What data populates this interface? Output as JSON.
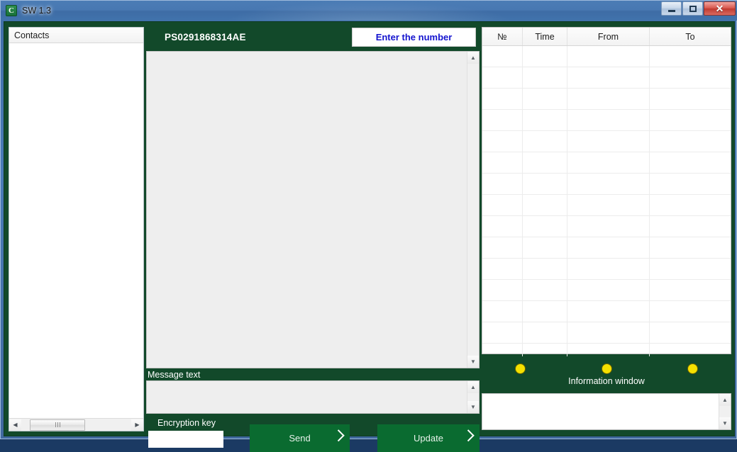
{
  "window": {
    "title": "SW 1.3",
    "app_icon": "app-logo-icon",
    "controls": {
      "minimize": "minimize-icon",
      "maximize": "maximize-icon",
      "close": "✕"
    }
  },
  "theme": {
    "dark_green": "#12492a",
    "button_green": "#0a6b30",
    "accent_blue": "#1414cf",
    "lamp_yellow": "#f5e000",
    "panel_gray": "#eeeeee"
  },
  "contacts": {
    "header": "Contacts",
    "items": [],
    "scrollbar": {
      "left_arrow": "◀",
      "right_arrow": "▶"
    }
  },
  "center": {
    "phone_number": "PS0291868314AE",
    "enter_number_button": "Enter the number",
    "message_display_value": "",
    "message_text_label": "Message text",
    "message_input_value": "",
    "encryption_key_label": "Encryption key",
    "encryption_key_value": "",
    "send_button": "Send",
    "update_button": "Update",
    "scroll_up": "▲",
    "scroll_down": "▼"
  },
  "log": {
    "columns": [
      "№",
      "Time",
      "From",
      "To"
    ],
    "rows": []
  },
  "info": {
    "label": "Information window",
    "lamps": [
      "yellow",
      "yellow",
      "yellow"
    ],
    "panel_value": ""
  }
}
